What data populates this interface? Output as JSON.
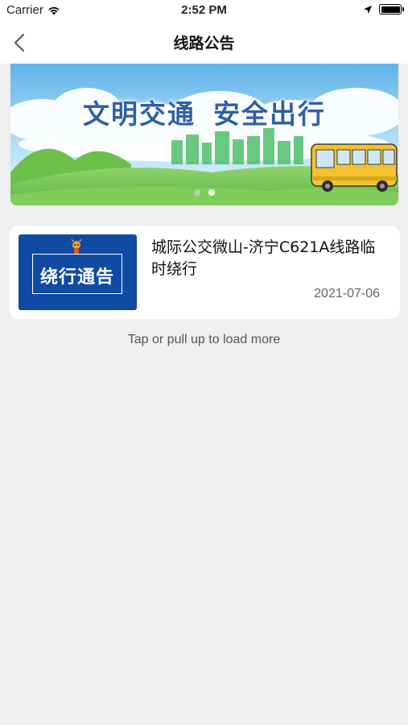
{
  "status_bar": {
    "carrier": "Carrier",
    "time": "2:52 PM",
    "battery_level": 1.0
  },
  "nav": {
    "title": "线路公告",
    "back_icon": "chevron-left-icon"
  },
  "banner": {
    "slogan_left": "文明交通",
    "slogan_right": "安全出行",
    "slide_count": 2,
    "active_slide": 1
  },
  "notices": [
    {
      "thumbnail_text": "绕行通告",
      "title": "城际公交微山-济宁C621A线路临时绕行",
      "date": "2021-07-06"
    }
  ],
  "footer": {
    "load_more": "Tap or pull up to load more"
  },
  "colors": {
    "page_bg": "#efefef",
    "thumb_bg": "#0f4aa3",
    "slogan": "#2f5fa8"
  }
}
